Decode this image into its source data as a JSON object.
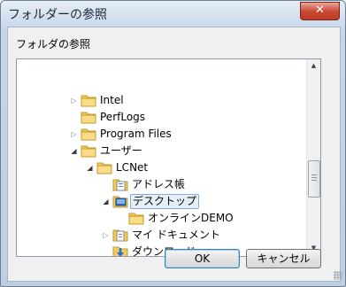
{
  "window": {
    "title": "フォルダーの参照",
    "close_label": "✕"
  },
  "dialog": {
    "prompt": "フォルダの参照"
  },
  "tree": {
    "items": [
      {
        "label": "Intel",
        "expander": "closed",
        "icon": "folder-icon"
      },
      {
        "label": "PerfLogs",
        "expander": "none",
        "icon": "folder-icon"
      },
      {
        "label": "Program Files",
        "expander": "closed",
        "icon": "folder-icon"
      },
      {
        "label": "ユーザー",
        "expander": "open",
        "icon": "folder-icon"
      },
      {
        "label": "LCNet",
        "expander": "open",
        "icon": "folder-icon"
      },
      {
        "label": "アドレス帳",
        "expander": "none",
        "icon": "address-book-icon"
      },
      {
        "label": "デスクトップ",
        "expander": "open",
        "icon": "desktop-folder-icon",
        "selected": true
      },
      {
        "label": "オンラインDEMO",
        "expander": "none",
        "icon": "folder-icon"
      },
      {
        "label": "マイ ドキュメント",
        "expander": "closed",
        "icon": "documents-folder-icon"
      },
      {
        "label": "ダウンロード",
        "expander": "none",
        "icon": "download-folder-icon"
      }
    ]
  },
  "buttons": {
    "ok": "OK",
    "cancel": "キャンセル"
  },
  "colors": {
    "accent": "#3c7fb1",
    "folder": "#f1c95d",
    "selection": "#e4effa"
  }
}
